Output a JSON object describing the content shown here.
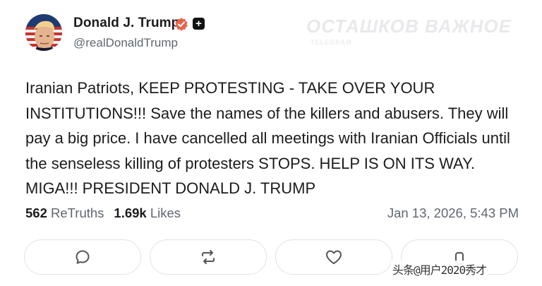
{
  "author": {
    "name": "Donald J. Trump",
    "handle": "@realDonaldTrump",
    "verified_icon": "verified-badge-icon",
    "plus_badge": "+"
  },
  "watermark": {
    "text": "ОСТАШКОВ ВАЖНОЕ",
    "sub": "TELEGRAM"
  },
  "post": {
    "text": "Iranian Patriots, KEEP PROTESTING - TAKE OVER YOUR INSTITUTIONS!!! Save the names of the killers and abusers. They will pay a big price. I have cancelled all meetings with Iranian Officials until the senseless killing of protesters STOPS. HELP IS ON ITS WAY. MIGA!!! PRESIDENT DONALD J. TRUMP"
  },
  "stats": {
    "retruths_count": "562",
    "retruths_label": "ReTruths",
    "likes_count": "1.69k",
    "likes_label": "Likes",
    "timestamp": "Jan 13, 2026, 5:43 PM"
  },
  "actions": [
    {
      "name": "reply",
      "icon": "comment-icon"
    },
    {
      "name": "retruth",
      "icon": "retruth-icon"
    },
    {
      "name": "like",
      "icon": "heart-icon"
    },
    {
      "name": "share",
      "icon": "share-icon"
    }
  ],
  "site_mark": "头条@用户2020秀才",
  "colors": {
    "text": "#1c1c1c",
    "muted": "#606770",
    "verified": "#e8624a",
    "border": "#e2e2e6"
  }
}
